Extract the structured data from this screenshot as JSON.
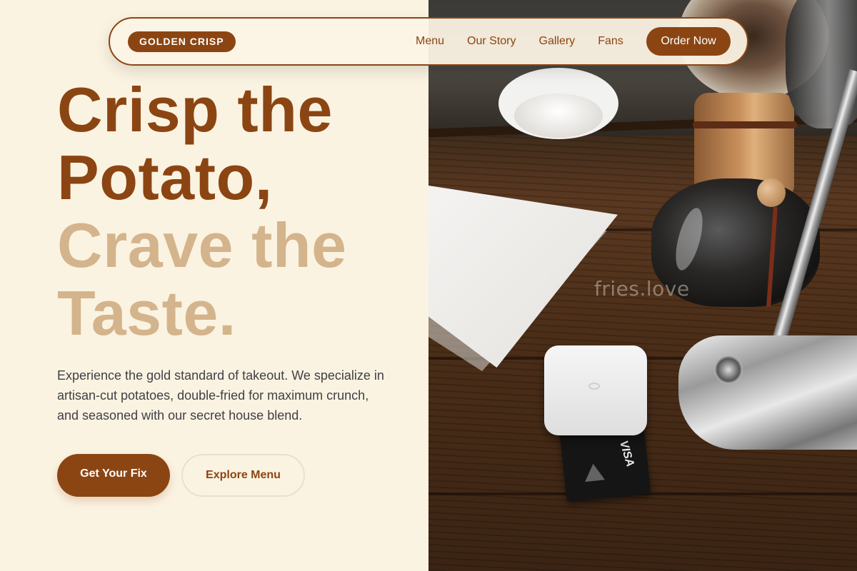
{
  "nav": {
    "logo": "GOLDEN CRISP",
    "links": [
      "Menu",
      "Our Story",
      "Gallery",
      "Fans"
    ],
    "cta": "Order Now"
  },
  "hero": {
    "headline_dark_1": "Crisp the",
    "headline_dark_2": "Potato,",
    "headline_light_1": "Crave the",
    "headline_light_2": "Taste.",
    "description": "Experience the gold standard of takeout. We specialize in artisan-cut potatoes, double-fried for maximum crunch, and seasoned with our secret house blend.",
    "primary_button": "Get Your Fix",
    "secondary_button": "Explore Menu"
  },
  "photo": {
    "watermark": "fries.love",
    "card_brand": "VISA"
  },
  "colors": {
    "brand_brown": "#8b4513",
    "light_tan": "#d4b48c",
    "cream_background": "#fbf3e1"
  }
}
